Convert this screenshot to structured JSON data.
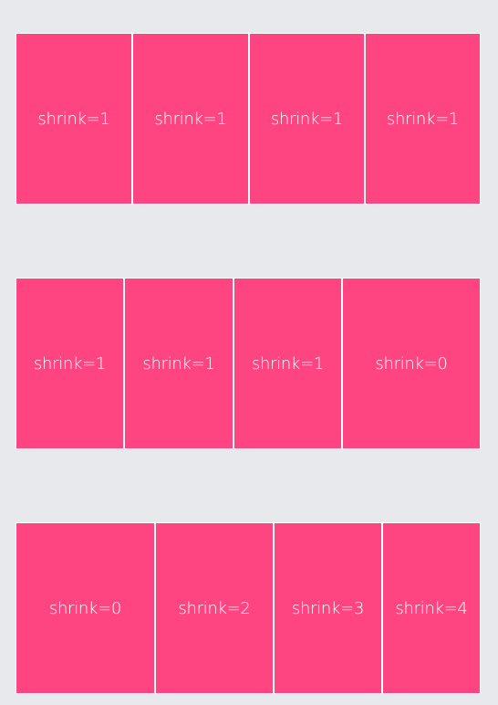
{
  "colors": {
    "background": "#e8e9ed",
    "item": "#ff4581",
    "item_text": "#ffffff"
  },
  "rows": [
    {
      "items": [
        {
          "label": "shrink=1"
        },
        {
          "label": "shrink=1"
        },
        {
          "label": "shrink=1"
        },
        {
          "label": "shrink=1"
        }
      ]
    },
    {
      "items": [
        {
          "label": "shrink=1"
        },
        {
          "label": "shrink=1"
        },
        {
          "label": "shrink=1"
        },
        {
          "label": "shrink=0"
        }
      ]
    },
    {
      "items": [
        {
          "label": "shrink=0"
        },
        {
          "label": "shrink=2"
        },
        {
          "label": "shrink=3"
        },
        {
          "label": "shrink=4"
        }
      ]
    }
  ]
}
